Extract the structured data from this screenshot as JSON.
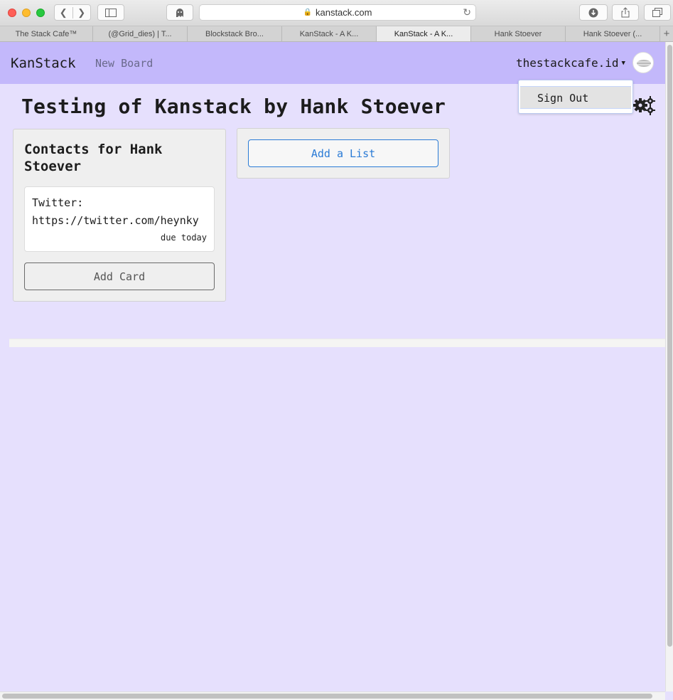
{
  "browser": {
    "url": "kanstack.com",
    "tabs": [
      {
        "label": "The Stack Cafe™",
        "active": false
      },
      {
        "label": "(@Grid_dies) | T...",
        "active": false
      },
      {
        "label": "Blockstack Bro...",
        "active": false
      },
      {
        "label": "KanStack - A K...",
        "active": false
      },
      {
        "label": "KanStack - A K...",
        "active": true
      },
      {
        "label": "Hank Stoever",
        "active": false
      },
      {
        "label": "Hank Stoever (...",
        "active": false
      }
    ],
    "new_tab_label": "+"
  },
  "navbar": {
    "brand": "KanStack",
    "new_board": "New Board",
    "username": "thestackcafe.id",
    "accent_color": "#c3b8fb"
  },
  "dropdown": {
    "sign_out": "Sign Out"
  },
  "board": {
    "title": "Testing of Kanstack by Hank Stoever",
    "background_color": "#e6e0fd",
    "lists": [
      {
        "title": "Contacts for Hank Stoever",
        "cards": [
          {
            "text": "Twitter:\nhttps://twitter.com/heynky",
            "due": "due today"
          }
        ],
        "add_card_label": "Add Card"
      }
    ],
    "add_list_label": "Add a List"
  }
}
